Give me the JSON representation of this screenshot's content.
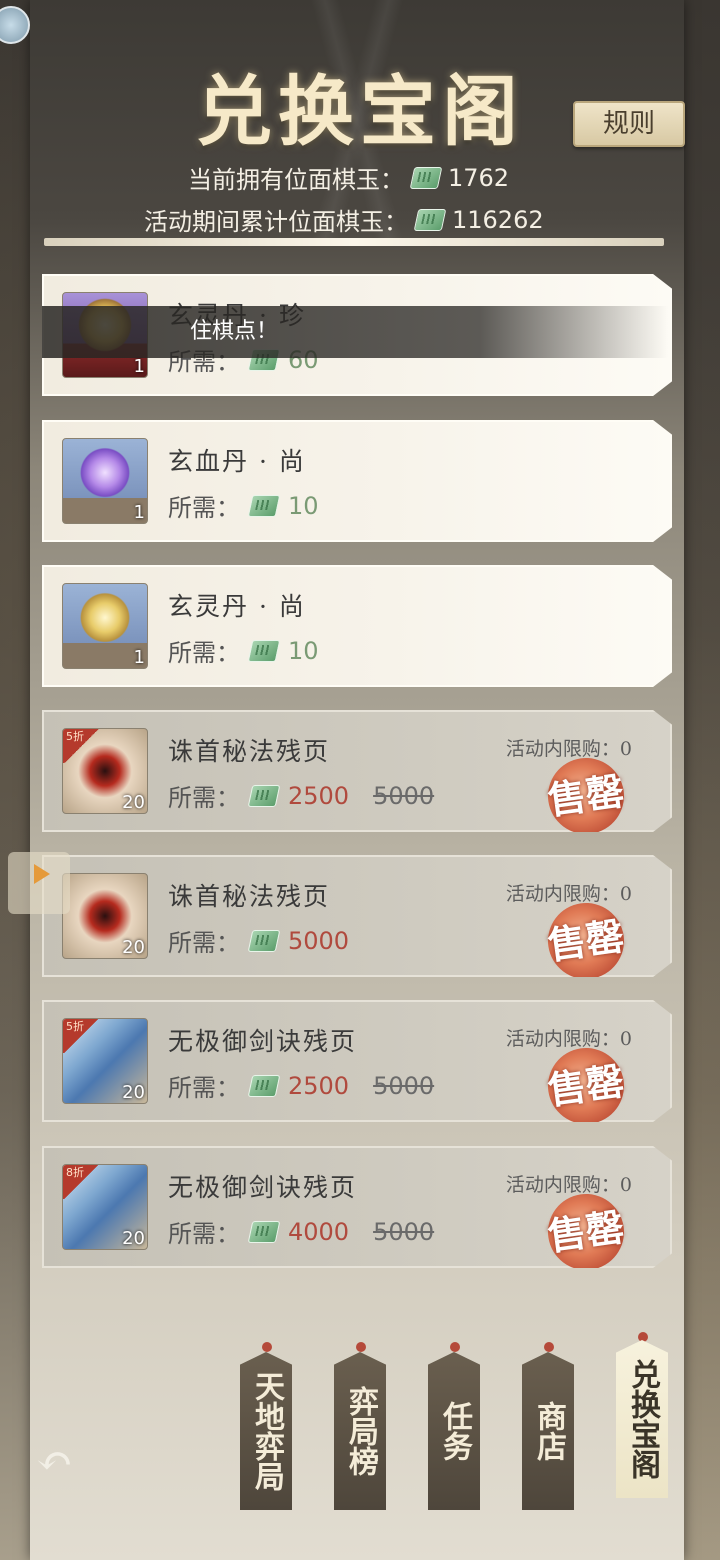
{
  "header": {
    "title": "兑换宝阁",
    "rules_label": "规则",
    "owned_label": "当前拥有位面棋玉：",
    "owned_value": "1762",
    "cumulative_label": "活动期间累计位面棋玉：",
    "cumulative_value": "116262"
  },
  "toast": "住棋点！",
  "cost_label": "所需：",
  "items": [
    {
      "name": "玄灵丹 · 珍",
      "count": "1",
      "cost": "60",
      "original": "",
      "limit": "",
      "discount": "",
      "sold_out": false,
      "icon": "golden-orb-on-stand-icon"
    },
    {
      "name": "玄血丹 · 尚",
      "count": "1",
      "cost": "10",
      "original": "",
      "limit": "",
      "discount": "",
      "sold_out": false,
      "icon": "purple-orb-icon"
    },
    {
      "name": "玄灵丹 · 尚",
      "count": "1",
      "cost": "10",
      "original": "",
      "limit": "",
      "discount": "",
      "sold_out": false,
      "icon": "golden-orb-icon"
    },
    {
      "name": "诛首秘法残页",
      "count": "20",
      "cost": "2500",
      "original": "5000",
      "limit": "活动内限购：0",
      "discount": "5折",
      "sold_out": true,
      "sold_out_label": "售罄",
      "icon": "red-scroll-icon"
    },
    {
      "name": "诛首秘法残页",
      "count": "20",
      "cost": "5000",
      "original": "",
      "limit": "活动内限购：0",
      "discount": "",
      "sold_out": true,
      "sold_out_label": "售罄",
      "icon": "red-scroll-icon"
    },
    {
      "name": "无极御剑诀残页",
      "count": "20",
      "cost": "2500",
      "original": "5000",
      "limit": "活动内限购：0",
      "discount": "5折",
      "sold_out": true,
      "sold_out_label": "售罄",
      "icon": "blue-sword-scroll-icon"
    },
    {
      "name": "无极御剑诀残页",
      "count": "20",
      "cost": "4000",
      "original": "5000",
      "limit": "活动内限购：0",
      "discount": "8折",
      "sold_out": true,
      "sold_out_label": "售罄",
      "icon": "blue-sword-scroll-icon"
    }
  ],
  "tabs": [
    {
      "label": "天地弈局",
      "active": false
    },
    {
      "label": "弈局榜",
      "active": false
    },
    {
      "label": "任务",
      "active": false
    },
    {
      "label": "商店",
      "active": false
    },
    {
      "label": "兑换宝阁",
      "active": true
    }
  ],
  "colors": {
    "accent_gold": "#f6e9c8",
    "sold_out": "#d06a4a",
    "price_red": "#b04a3e",
    "price_green": "#7a9a74"
  }
}
